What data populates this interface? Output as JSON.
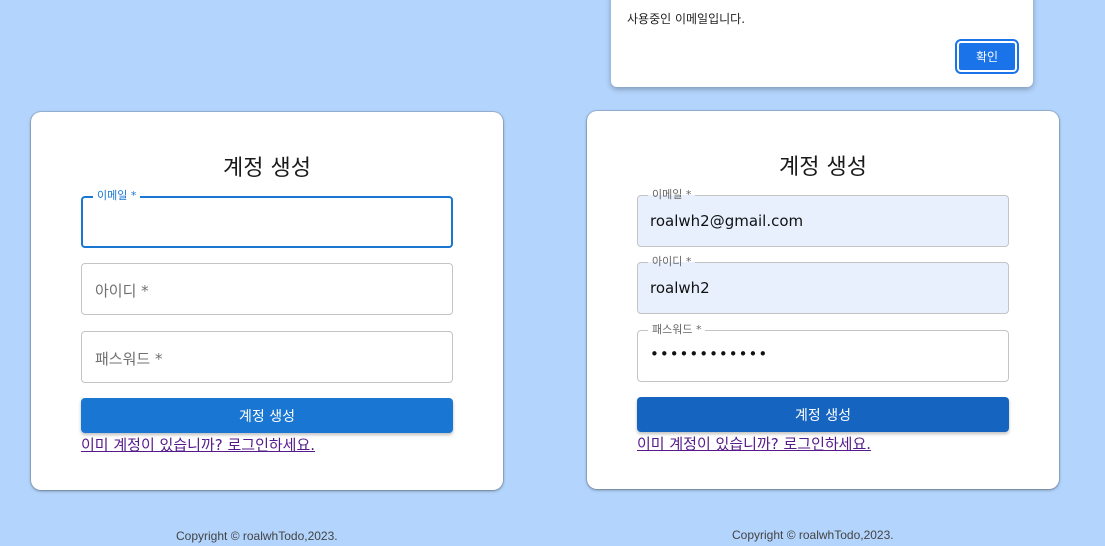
{
  "left_form": {
    "title": "계정 생성",
    "email_label": "이메일 *",
    "id_label": "아이디 *",
    "password_label": "패스워드 *",
    "submit_label": "계정 생성",
    "login_link": "이미 계정이 있습니까? 로그인하세요."
  },
  "right_form": {
    "title": "계정 생성",
    "email_label": "이메일 *",
    "email_value": "roalwh2@gmail.com",
    "id_label": "아이디 *",
    "id_value": "roalwh2",
    "password_label": "패스워드 *",
    "password_value": "••••••••••••",
    "submit_label": "계정 생성",
    "login_link": "이미 계정이 있습니까? 로그인하세요."
  },
  "alert": {
    "message": "사용중인 이메일입니다.",
    "ok_label": "확인"
  },
  "footer": {
    "left": "Copyright © roalwhTodo,2023.",
    "right": "Copyright © roalwhTodo,2023."
  },
  "colors": {
    "background": "#b3d4fc",
    "primary": "#1976d2",
    "link": "#551a8b",
    "autofill": "#e8f0fe"
  }
}
